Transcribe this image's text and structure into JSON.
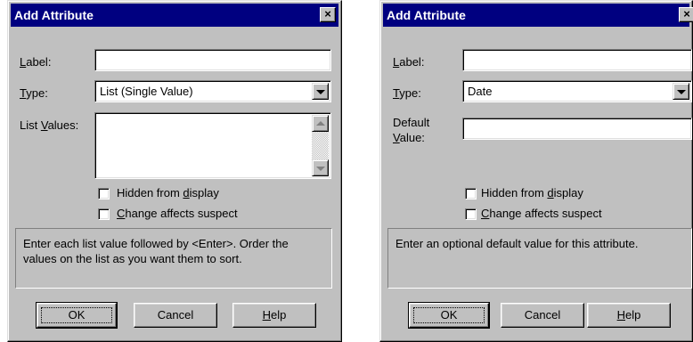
{
  "dialog_list": {
    "title": "Add Attribute",
    "close_glyph": "×",
    "label_field": {
      "caption_pre": "",
      "caption_key": "L",
      "caption_post": "abel:",
      "value": ""
    },
    "type_field": {
      "caption_pre": "",
      "caption_key": "T",
      "caption_post": "ype:",
      "selected": "List (Single Value)"
    },
    "list_values": {
      "caption_pre": "List ",
      "caption_key": "V",
      "caption_post": "alues:",
      "value": ""
    },
    "hidden_checkbox": {
      "pre": "Hidden from ",
      "key": "d",
      "post": "isplay",
      "checked": false
    },
    "change_checkbox": {
      "pre": "",
      "key": "C",
      "post": "hange affects suspect",
      "checked": false
    },
    "hint": "Enter each list value followed by <Enter>. Order the values on the list as you want them to sort.",
    "buttons": {
      "ok": "OK",
      "cancel": "Cancel",
      "help_key": "H",
      "help_post": "elp"
    }
  },
  "dialog_date": {
    "title": "Add Attribute",
    "close_glyph": "×",
    "label_field": {
      "caption_pre": "",
      "caption_key": "L",
      "caption_post": "abel:",
      "value": ""
    },
    "type_field": {
      "caption_pre": "",
      "caption_key": "T",
      "caption_post": "ype:",
      "selected": "Date"
    },
    "default_value": {
      "line1": "Default",
      "line2_key": "V",
      "line2_post": "alue:",
      "value": ""
    },
    "hidden_checkbox": {
      "pre": "Hidden from ",
      "key": "d",
      "post": "isplay",
      "checked": false
    },
    "change_checkbox": {
      "pre": "",
      "key": "C",
      "post": "hange affects suspect",
      "checked": false
    },
    "hint": "Enter an optional default value for this attribute.",
    "buttons": {
      "ok": "OK",
      "cancel": "Cancel",
      "help_key": "H",
      "help_post": "elp"
    }
  },
  "colors": {
    "titlebar": "#000080",
    "dialog_face": "#c0c0c0"
  }
}
